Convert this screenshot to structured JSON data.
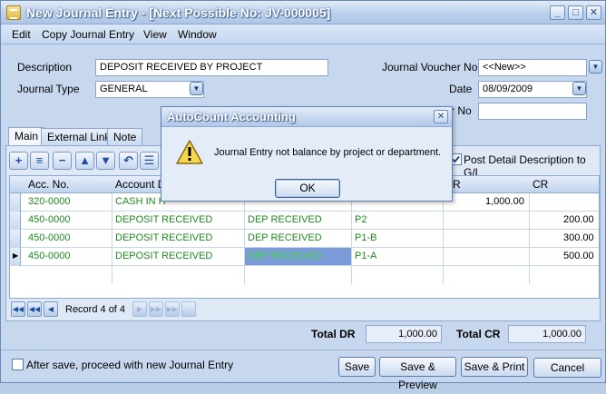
{
  "window": {
    "title": "New Journal Entry - [Next Possible No: JV-000005]",
    "minimize": "_",
    "maximize": "□",
    "close": "✕"
  },
  "menu": [
    "Edit",
    "Copy Journal Entry",
    "View",
    "Window"
  ],
  "form": {
    "description_label": "Description",
    "description_value": "DEPOSIT RECEIVED BY PROJECT",
    "journal_type_label": "Journal Type",
    "journal_type_value": "GENERAL",
    "voucher_label": "Journal Voucher No",
    "voucher_value": "<<New>>",
    "date_label": "Date",
    "date_value": "08/09/2009",
    "third_label_partial": "r No",
    "third_value": ""
  },
  "tabs": [
    "Main",
    "External Link",
    "Note"
  ],
  "post_detail_label": "Post Detail Description to G/L",
  "grid": {
    "headers": [
      "Acc. No.",
      "Account D",
      "",
      "",
      "R",
      "CR"
    ],
    "rows": [
      {
        "acc": "320-0000",
        "account": "CASH IN H",
        "desc": "",
        "proj": "",
        "dr": "1,000.00",
        "cr": ""
      },
      {
        "acc": "450-0000",
        "account": "DEPOSIT RECEIVED",
        "desc": "DEP RECEIVED",
        "proj": "P2",
        "dr": "",
        "cr": "200.00"
      },
      {
        "acc": "450-0000",
        "account": "DEPOSIT RECEIVED",
        "desc": "DEP RECEIVED",
        "proj": "P1-B",
        "dr": "",
        "cr": "300.00"
      },
      {
        "acc": "450-0000",
        "account": "DEPOSIT RECEIVED",
        "desc": "DEP RECEIVED",
        "proj": "P1-A",
        "dr": "",
        "cr": "500.00"
      }
    ]
  },
  "navigator": {
    "record_text": "Record 4 of 4"
  },
  "totals": {
    "dr_label": "Total DR",
    "dr_value": "1,000.00",
    "cr_label": "Total CR",
    "cr_value": "1,000.00"
  },
  "bottom": {
    "after_save_label": "After save, proceed with new Journal Entry",
    "save": "Save",
    "save_preview": "Save & Preview",
    "save_print": "Save & Print",
    "cancel": "Cancel"
  },
  "dialog": {
    "title": "AutoCount Accounting",
    "message": "Journal Entry not balance by project or department.",
    "ok": "OK"
  },
  "colors": {
    "accent_green": "#1f8a1f",
    "selected_cell": "#7b9bd8"
  }
}
